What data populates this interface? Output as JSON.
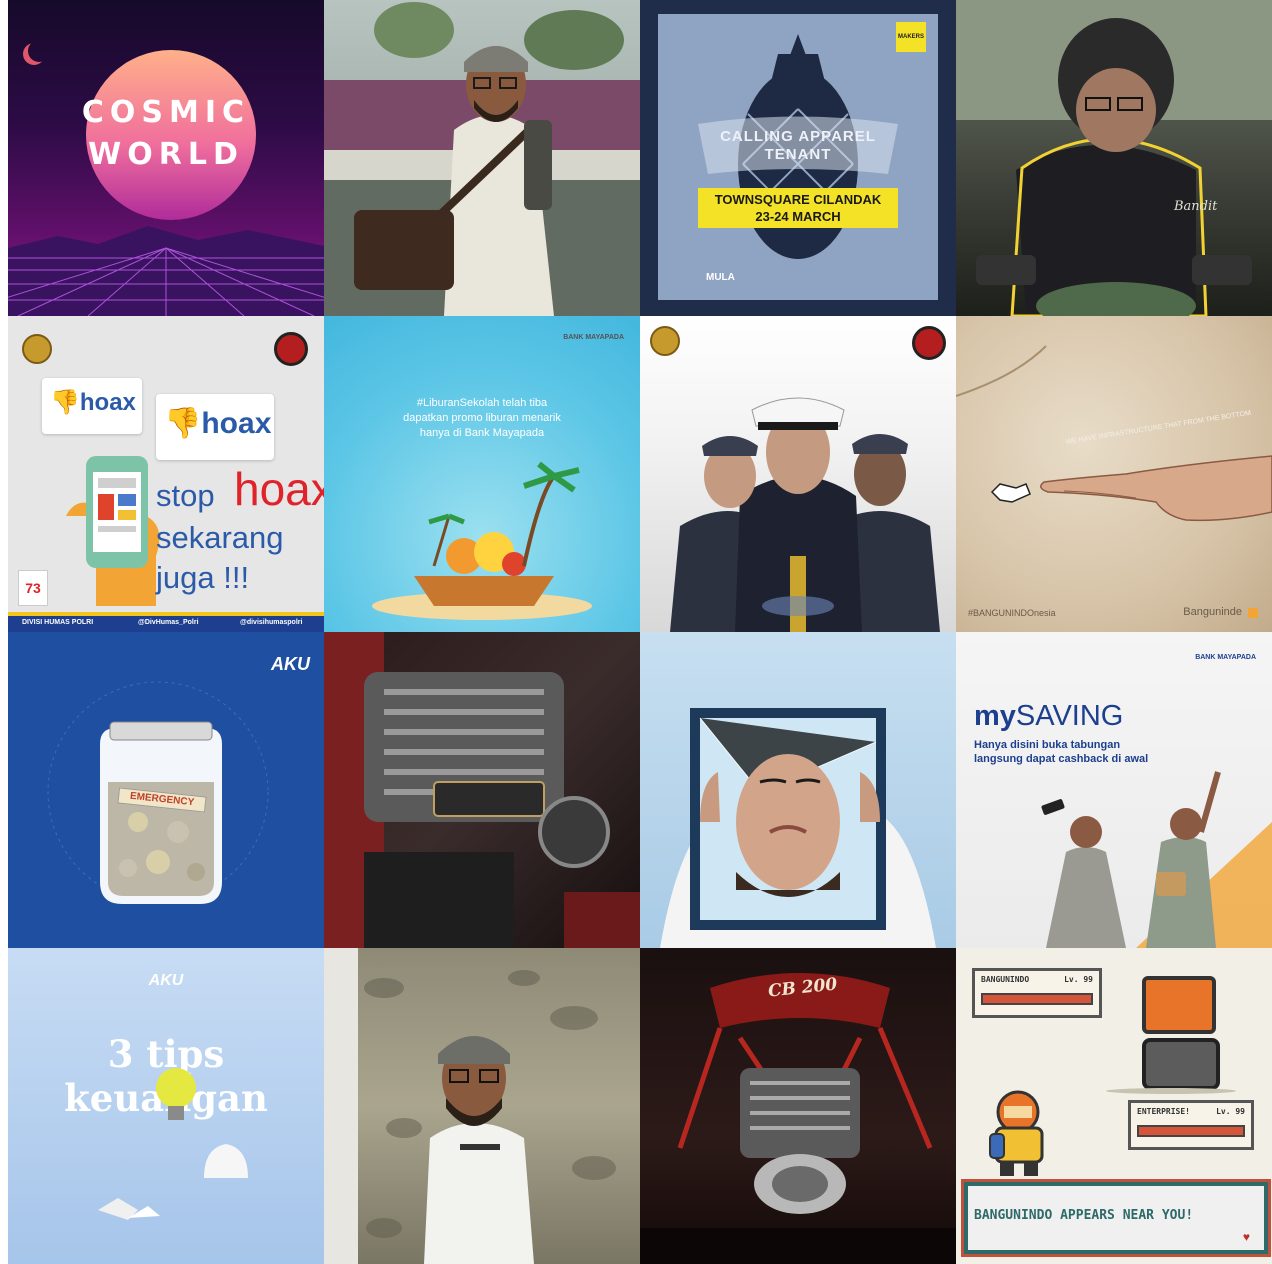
{
  "tiles": {
    "cosmic": {
      "line1": "COSMIC",
      "line2": "WORLD"
    },
    "apparel": {
      "heading_line1": "CALLING APPAREL",
      "heading_line2": "TENANT",
      "venue": "TOWNSQUARE CILANDAK",
      "dates": "23-24 MARCH",
      "sponsor": "MULA"
    },
    "hoax": {
      "bubble1": "hoax",
      "bubble2": "hoax",
      "stop": "stop",
      "red_word": "hoax",
      "line2": "sekarang",
      "line3": "juga !!!",
      "footer_fb": "DIVISI HUMAS POLRI",
      "footer_tw": "@DivHumas_Polri",
      "footer_ig": "@divisihumaspolri"
    },
    "liburan": {
      "line1": "#LiburanSekolah telah tiba",
      "line2": "dapatkan promo liburan menarik",
      "line3": "hanya di Bank Mayapada",
      "logo": "BANK MAYAPADA"
    },
    "hand": {
      "hashtag": "#BANGUNINDOnesia",
      "logo": "Banguninde"
    },
    "emergency": {
      "brand": "AKU",
      "jar_label": "EMERGENCY"
    },
    "mysaving": {
      "title_prefix": "my",
      "title_main": "SAVING",
      "sub_line1": "Hanya disini buka tabungan",
      "sub_line2": "langsung dapat cashback di awal",
      "logo": "BANK MAYAPADA"
    },
    "tips": {
      "brand": "AKU",
      "line1": "3 tips",
      "line2": "keuangan"
    },
    "cb": {
      "badge": "CB 200"
    },
    "pixel": {
      "enemy_name": "BANGUNINDO",
      "enemy_level": "Lv. 99",
      "player_name": "ENTERPRISE!",
      "player_level": "Lv. 99",
      "message": "BANGUNINDO APPEARS NEAR YOU!"
    }
  },
  "colors": {
    "polri_blue": "#2b5ba8",
    "hoax_red": "#e0232b",
    "apparel_yellow": "#f4e227",
    "mayapada_blue": "#1d3f8f"
  }
}
